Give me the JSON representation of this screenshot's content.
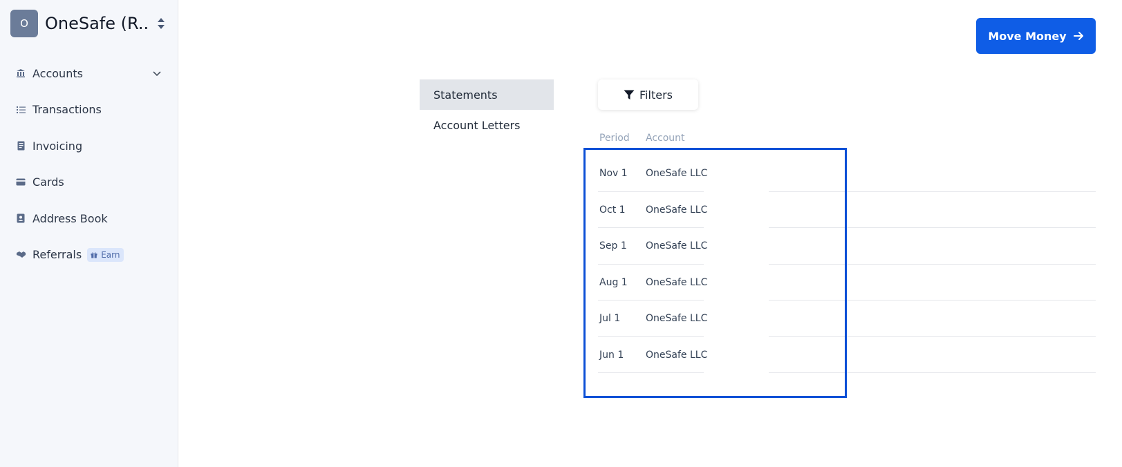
{
  "sidebar": {
    "org": {
      "initial": "O",
      "name": "OneSafe (R..."
    },
    "items": [
      {
        "label": "Accounts",
        "icon": "bank-icon"
      },
      {
        "label": "Transactions",
        "icon": "list-icon"
      },
      {
        "label": "Invoicing",
        "icon": "receipt-icon"
      },
      {
        "label": "Cards",
        "icon": "card-icon"
      },
      {
        "label": "Address Book",
        "icon": "address-book-icon"
      },
      {
        "label": "Referrals",
        "icon": "handshake-icon",
        "badge": "Earn"
      }
    ]
  },
  "header": {
    "move_money_label": "Move Money"
  },
  "documents": {
    "tabs": [
      {
        "label": "Statements",
        "active": true
      },
      {
        "label": "Account Letters",
        "active": false
      }
    ],
    "filters_label": "Filters",
    "columns": {
      "period": "Period",
      "account": "Account"
    },
    "rows": [
      {
        "period": "Nov 1",
        "account": "OneSafe LLC"
      },
      {
        "period": "Oct 1",
        "account": "OneSafe LLC"
      },
      {
        "period": "Sep 1",
        "account": "OneSafe LLC"
      },
      {
        "period": "Aug 1",
        "account": "OneSafe LLC"
      },
      {
        "period": "Jul 1",
        "account": "OneSafe LLC"
      },
      {
        "period": "Jun 1",
        "account": "OneSafe LLC"
      }
    ]
  },
  "colors": {
    "primary": "#0f5de6",
    "highlight": "#0b4fd6",
    "sidebar_bg": "#f5f7fb"
  }
}
